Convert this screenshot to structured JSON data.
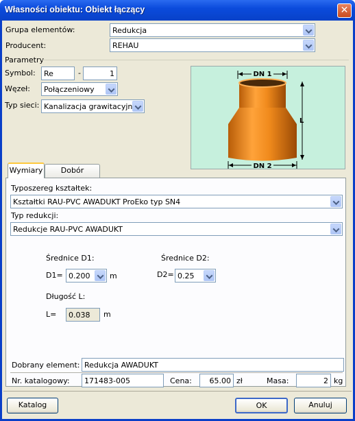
{
  "window": {
    "title": "Własności obiektu: Obiekt łączący",
    "close_glyph": "✕"
  },
  "top": {
    "group_label": "Grupa elementów:",
    "group_value": "Redukcja",
    "producer_label": "Producent:",
    "producer_value": "REHAU"
  },
  "params": {
    "title": "Parametry",
    "symbol_label": "Symbol:",
    "symbol_prefix": "Re",
    "symbol_sep": "-",
    "symbol_num": "1",
    "node_label": "Węzeł:",
    "node_value": "Połączeniowy",
    "net_label": "Typ sieci:",
    "net_value": "Kanalizacja grawitacyjna"
  },
  "diagram": {
    "dn1": "DN 1",
    "dn2": "DN 2",
    "l": "L",
    "bg": "#c6f0dd",
    "pipe": "#f08a1c"
  },
  "tabs": [
    {
      "label": "Wymiary"
    },
    {
      "label": "Dobór średnicy"
    }
  ],
  "dims": {
    "series_label": "Typoszereg kształtek:",
    "series_value": "Kształtki RAU-PVC AWADUKT ProEko typ SN4",
    "reduction_label": "Typ redukcji:",
    "reduction_value": "Redukcje RAU-PVC AWADUKT",
    "d1_heading": "Średnice D1:",
    "d1_label": "D1=",
    "d1_value": "0.200",
    "d1_unit": "m",
    "d2_heading": "Średnice D2:",
    "d2_label": "D2=",
    "d2_value": "0.25",
    "len_heading": "Długość L:",
    "len_label": "L=",
    "len_value": "0.038",
    "len_unit": "m"
  },
  "result": {
    "chosen_label": "Dobrany element:",
    "chosen_value": "Redukcja AWADUKT",
    "catalog_label": "Nr. katalogowy:",
    "catalog_value": "171483-005",
    "price_label": "Cena:",
    "price_value": "65.00",
    "price_unit": "zł",
    "mass_label": "Masa:",
    "mass_value": "2",
    "mass_unit": "kg"
  },
  "buttons": {
    "catalog": "Katalog",
    "ok": "OK",
    "cancel": "Anuluj"
  }
}
